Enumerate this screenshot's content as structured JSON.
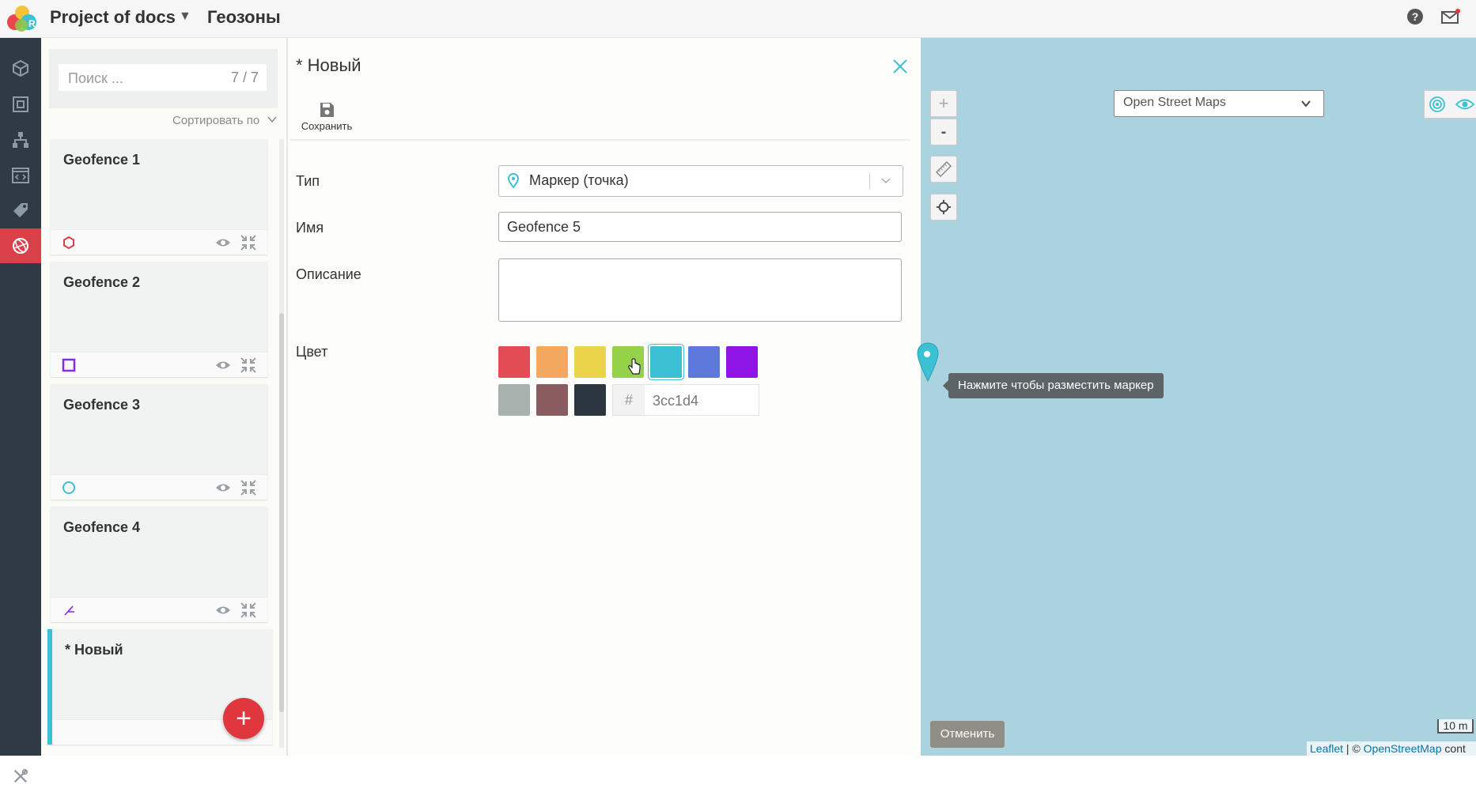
{
  "header": {
    "project_name": "Project of docs",
    "section_title": "Геозоны"
  },
  "list": {
    "search_placeholder": "Поиск ...",
    "count": "7 / 7",
    "sort_label": "Сортировать по",
    "items": [
      {
        "title": "Geofence 1",
        "shape": "hexagon-icon",
        "color": "#d9404a"
      },
      {
        "title": "Geofence 2",
        "shape": "square-icon",
        "color": "#8a2be2"
      },
      {
        "title": "Geofence 3",
        "shape": "circle-icon",
        "color": "#3cc1d4"
      },
      {
        "title": "Geofence 4",
        "shape": "polyline-icon",
        "color": "#8a2be2"
      },
      {
        "title": "* Новый",
        "selected": true
      }
    ],
    "add_button": "+"
  },
  "form": {
    "header": "* Новый",
    "save_label": "Сохранить",
    "type_label": "Тип",
    "type_value": "Маркер (точка)",
    "name_label": "Имя",
    "name_value": "Geofence 5",
    "description_label": "Описание",
    "description_value": "",
    "color_label": "Цвет",
    "colors": [
      "#e34b55",
      "#f3a85f",
      "#ebd44a",
      "#96d14a",
      "#3cc1d4",
      "#5f78dc",
      "#8f14e6",
      "#a7b2ae",
      "#8a5b5f",
      "#2c3641"
    ],
    "selected_color": "#3cc1d4",
    "hex_prefix": "#",
    "hex_value": "3cc1d4"
  },
  "map": {
    "zoom_in": "+",
    "zoom_out": "-",
    "layer_select": "Open Street Maps",
    "tooltip": "Нажмите чтобы разместить маркер",
    "cancel_label": "Отменить",
    "scale": "10 m",
    "attribution_leaflet": "Leaflet",
    "attribution_sep": " | © ",
    "attribution_osm": "OpenStreetMap",
    "attribution_tail": " cont"
  }
}
